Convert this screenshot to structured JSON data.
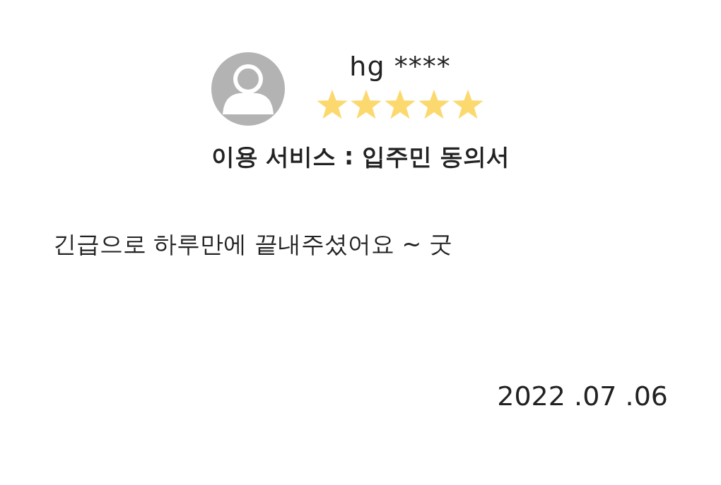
{
  "reviewer": {
    "name": "hg ****",
    "stars": 5
  },
  "service": "이용 서비스 : 입주민 동의서",
  "review": "긴급으로 하루만에 끝내주셨어요 ~ 굿",
  "date": "2022 .07 .06"
}
